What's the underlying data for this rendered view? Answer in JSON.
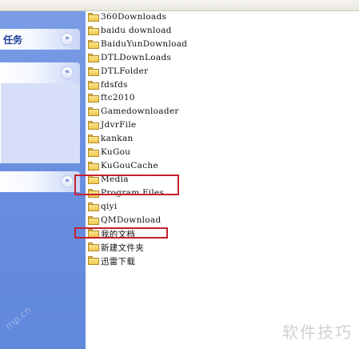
{
  "left_pane": {
    "task_panel_title": "任务",
    "panels": [
      {
        "expanded": false,
        "chevron": "»"
      },
      {
        "expanded": true,
        "chevron": "«"
      },
      {
        "expanded": false,
        "chevron": "»"
      }
    ]
  },
  "files": [
    "360Downloads",
    "baidu download",
    "BaiduYunDownload",
    "DTLDownLoads",
    "DTLFolder",
    "fdsfds",
    "ftc2010",
    "Gamedownloader",
    "JdvrFile",
    "kankan",
    "KuGou",
    "KuGouCache",
    "Media",
    "Program Files",
    "qiyi",
    "QMDownload",
    "我的文档",
    "新建文件夹",
    "迅雷下载"
  ],
  "highlighted": [
    "KuGouCache / Media",
    "QMDownload"
  ],
  "colors": {
    "highlight": "#c4202f",
    "task_pane": "#6b8fe0",
    "folder": "#f0c84e"
  },
  "watermark": "软件技巧",
  "side_watermark": "mp.cn"
}
